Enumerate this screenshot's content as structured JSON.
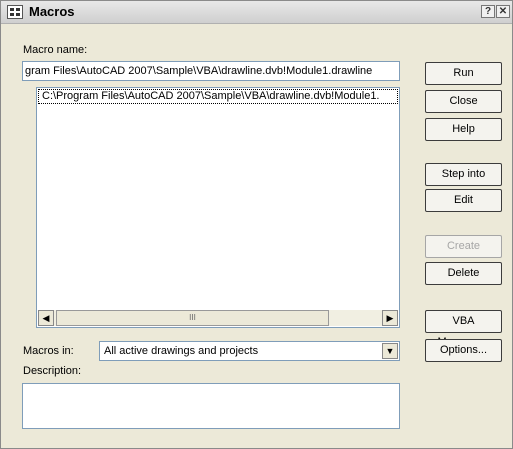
{
  "window": {
    "title": "Macros",
    "help_glyph": "?",
    "close_glyph": "✕"
  },
  "macro_name": {
    "label": "Macro name:",
    "value": "gram Files\\AutoCAD 2007\\Sample\\VBA\\drawline.dvb!Module1.drawline"
  },
  "macro_list": {
    "items": [
      "C:\\Program Files\\AutoCAD 2007\\Sample\\VBA\\drawline.dvb!Module1."
    ],
    "scroll_left_glyph": "◀",
    "scroll_right_glyph": "▶",
    "thumb_grip": "III"
  },
  "buttons": {
    "run": "Run",
    "close": "Close",
    "help": "Help",
    "step_into": "Step into",
    "edit": "Edit",
    "create": "Create",
    "delete": "Delete",
    "vba_manager": "VBA Manager...",
    "options": "Options..."
  },
  "macros_in": {
    "label": "Macros in:",
    "selected": "All active drawings and projects",
    "dropdown_glyph": "▼"
  },
  "description": {
    "label": "Description:",
    "value": ""
  },
  "icons": {
    "app": "macros-app-icon",
    "help": "help-icon",
    "close": "close-icon",
    "scroll_left": "scroll-left-icon",
    "scroll_right": "scroll-right-icon",
    "dropdown": "chevron-down-icon"
  },
  "colors": {
    "dialog_bg": "#ece9d8",
    "field_border": "#7f9db9",
    "disabled_text": "#a6a6a6"
  }
}
